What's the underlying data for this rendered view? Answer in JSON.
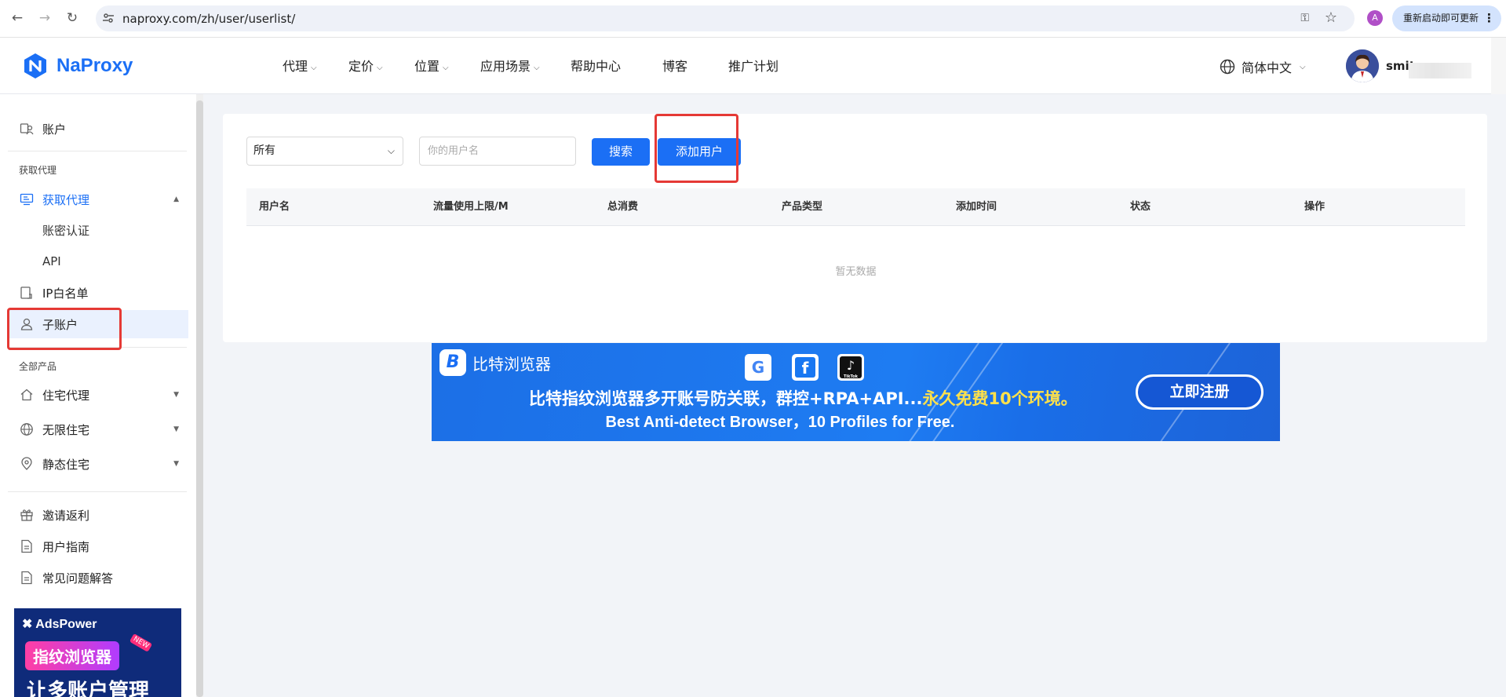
{
  "browser": {
    "url": "naproxy.com/zh/user/userlist/",
    "profile_initial": "A",
    "update_label": "重新启动即可更新"
  },
  "header": {
    "logo_text": "NaProxy",
    "nav": [
      "代理",
      "定价",
      "位置",
      "应用场景",
      "帮助中心",
      "博客",
      "推广计划"
    ],
    "language": "简体中文",
    "username": "smit"
  },
  "sidebar": {
    "account": "账户",
    "group_get_proxy": "获取代理",
    "get_proxy": "获取代理",
    "account_auth": "账密认证",
    "api": "API",
    "ip_whitelist": "IP白名单",
    "sub_account": "子账户",
    "group_all_products": "全部产品",
    "residential": "住宅代理",
    "unlimited_residential": "无限住宅",
    "static_residential": "静态住宅",
    "invite": "邀请返利",
    "user_guide": "用户指南",
    "faq": "常见问题解答"
  },
  "ad_adspower": {
    "brand": "AdsPower",
    "pill": "指纹浏览器",
    "badge": "NEW",
    "headline": "让多账户管理"
  },
  "filters": {
    "select_value": "所有",
    "username_placeholder": "你的用户名",
    "search_label": "搜索",
    "add_user_label": "添加用户"
  },
  "table": {
    "columns": [
      "用户名",
      "流量使用上限/M",
      "总消费",
      "产品类型",
      "添加时间",
      "状态",
      "操作"
    ],
    "empty_text": "暂无数据"
  },
  "ad_bitbrowser": {
    "brand": "比特浏览器",
    "line1_main": "比特指纹浏览器多开账号防关联，群控+RPA+API...",
    "line1_highlight": "永久免费10个环境。",
    "line2": "Best Anti-detect Browser，10 Profiles for Free.",
    "cta": "立即注册",
    "tiktok_label": "TikTok"
  },
  "colors": {
    "primary": "#1b6ff5",
    "highlight_box": "#e53935"
  }
}
